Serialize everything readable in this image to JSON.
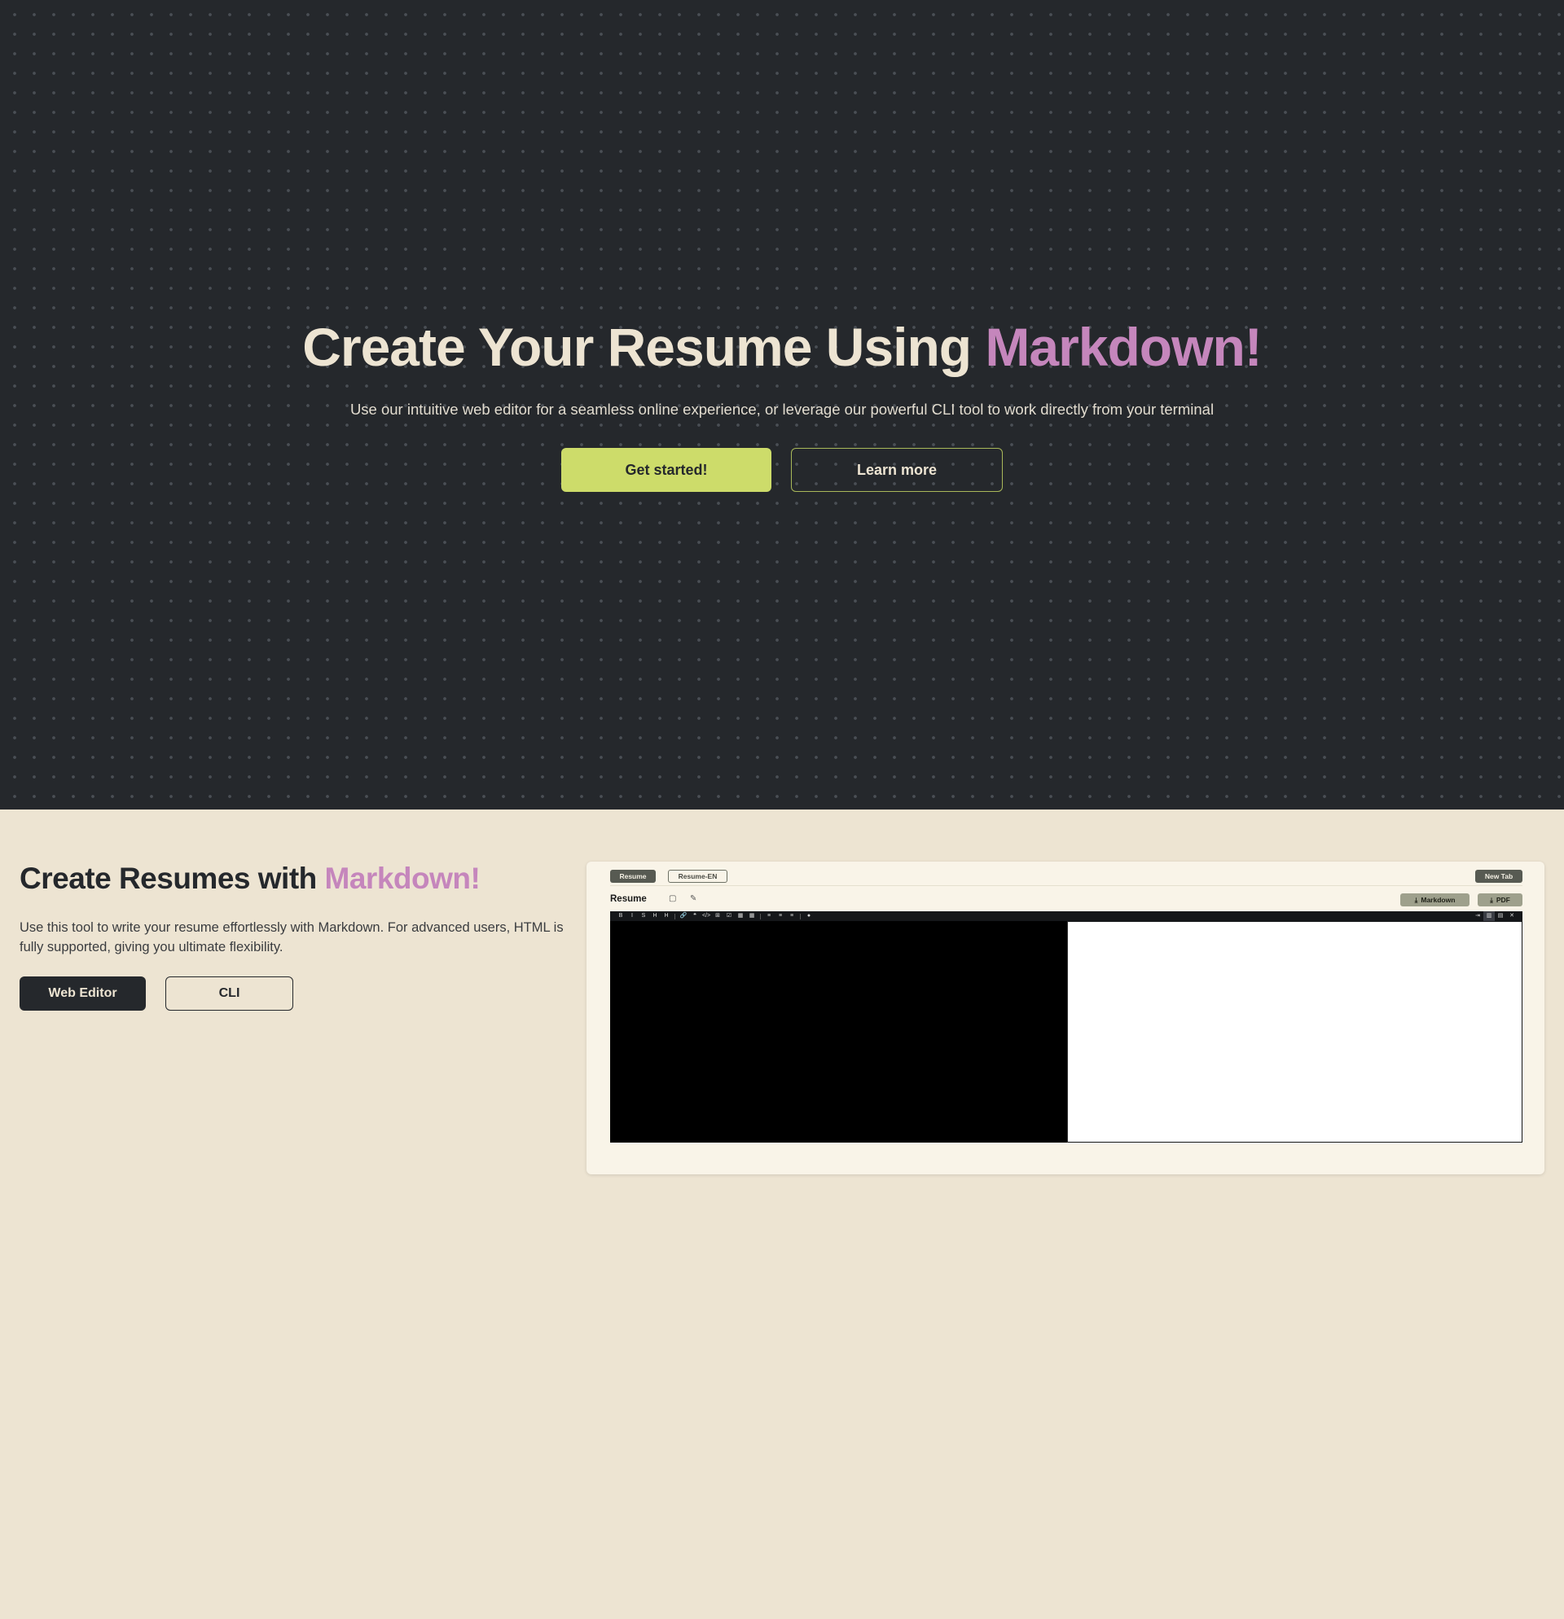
{
  "hero": {
    "title_main": "Create Your Resume Using ",
    "title_accent": "Markdown!",
    "subtitle": "Use our intuitive web editor for a seamless online experience, or leverage our powerful CLI tool to work directly from your terminal",
    "primary_button": "Get started!",
    "secondary_button": "Learn more"
  },
  "feature": {
    "title_main": "Create Resumes with ",
    "title_accent": "Markdown!",
    "description": "Use this tool to write your resume effortlessly with Markdown. For advanced users, HTML is fully supported, giving you ultimate flexibility.",
    "web_editor_button": "Web Editor",
    "cli_button": "CLI"
  },
  "preview": {
    "tabs": [
      "Resume",
      "Resume-EN"
    ],
    "new_tab_button": "New Tab",
    "document_title": "Resume",
    "download_markdown": "Markdown",
    "download_pdf": "PDF",
    "toolbar_left": [
      "B",
      "I",
      "S",
      "H",
      "H",
      "🔗",
      "❝",
      "</>",
      "⊞",
      "☑",
      "▦",
      "▦",
      "≡",
      "≡",
      "≡",
      "●"
    ],
    "toolbar_right": [
      "⇥",
      "▥",
      "▤",
      "✕"
    ]
  },
  "colors": {
    "hero_bg": "#25282c",
    "page_bg": "#ede4d2",
    "accent_pink": "#c586bc",
    "accent_lime": "#cddc6a",
    "card_bg": "#f9f4e8"
  }
}
